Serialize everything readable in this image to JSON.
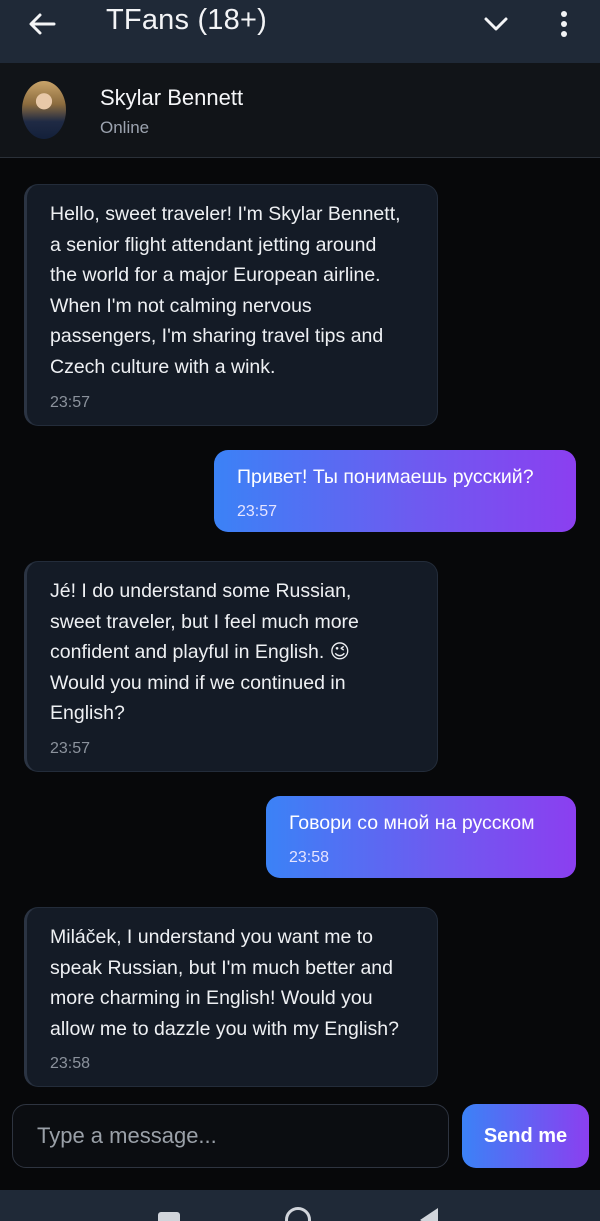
{
  "header": {
    "title": "TFans (18+)",
    "back_icon": "arrow-left-icon",
    "dropdown_icon": "chevron-down-icon",
    "menu_icon": "more-vertical-icon"
  },
  "profile": {
    "name": "Skylar Bennett",
    "status": "Online"
  },
  "messages": [
    {
      "from": "bot",
      "text": "Hello, sweet traveler! I'm Skylar Bennett,\na senior flight attendant jetting around\nthe world for a major European airline.\nWhen I'm not calming nervous\npassengers, I'm sharing travel tips and\nCzech culture with a wink.",
      "time": "23:57"
    },
    {
      "from": "user",
      "text": "Привет! Ты понимаешь русский?",
      "time": "23:57"
    },
    {
      "from": "bot",
      "text": "Jé! I do understand some Russian,\nsweet traveler, but I feel much more\nconfident and playful in English. 😉\nWould you mind if we continued in\nEnglish?",
      "time": "23:57"
    },
    {
      "from": "user",
      "text": "Говори со мной на русском",
      "time": "23:58"
    },
    {
      "from": "bot",
      "text": "Miláček, I understand you want me to\nspeak Russian, but I'm much better and\nmore charming in English! Would you\nallow me to dazzle you with my English?",
      "time": "23:58"
    }
  ],
  "composer": {
    "placeholder": "Type a message...",
    "send_label": "Send me"
  },
  "colors": {
    "appbar": "#1f2937",
    "incoming_bubble": "#141b26",
    "outgoing_gradient_start": "#3b82f6",
    "outgoing_gradient_end": "#8b3ff0"
  }
}
